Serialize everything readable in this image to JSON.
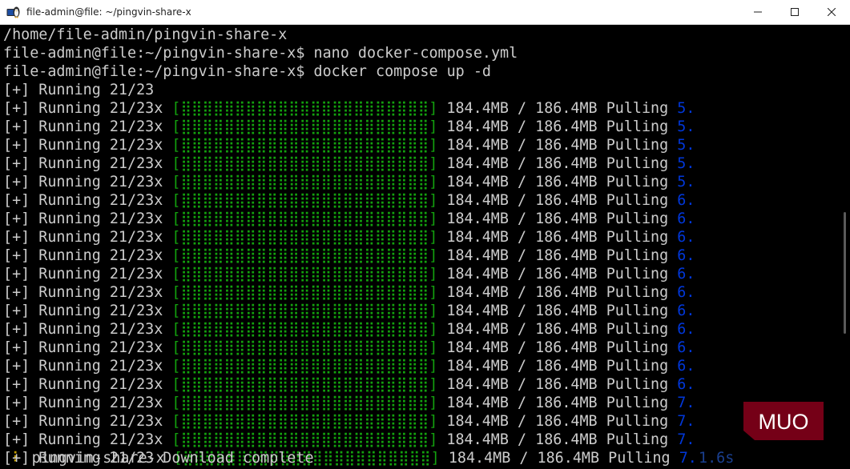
{
  "window": {
    "title": "file-admin@file: ~/pingvin-share-x",
    "app_icon": "penguin-terminal-icon",
    "buttons": {
      "minimize": "minimize-icon",
      "maximize": "maximize-icon",
      "close": "close-icon"
    }
  },
  "terminal": {
    "colors": {
      "background": "#000000",
      "text": "#cccccc",
      "progress": "#13a10e",
      "status": "#0037da"
    },
    "lines": [
      {
        "text": "/home/file-admin/pingvin-share-x"
      },
      {
        "text": "file-admin@file:~/pingvin-share-x$ nano docker-compose.yml"
      },
      {
        "text": "file-admin@file:~/pingvin-share-x$ docker compose up -d"
      },
      {
        "text": "[+] Running 21/23"
      }
    ],
    "progress_rows": [
      {
        "prefix": "[+] Running 21/23x ",
        "bar": "[⣿⣿⣿⣿⣿⣿⣿⣿⣿⣿⣿⣿⣿⣿⣿⣿⣿⣿⣿⣿⣿⣿⣿]",
        "size": " 184.4MB / 186.4MB Pulling ",
        "status": "5."
      },
      {
        "prefix": "[+] Running 21/23x ",
        "bar": "[⣿⣿⣿⣿⣿⣿⣿⣿⣿⣿⣿⣿⣿⣿⣿⣿⣿⣿⣿⣿⣿⣿⣿]",
        "size": " 184.4MB / 186.4MB Pulling ",
        "status": "5."
      },
      {
        "prefix": "[+] Running 21/23x ",
        "bar": "[⣿⣿⣿⣿⣿⣿⣿⣿⣿⣿⣿⣿⣿⣿⣿⣿⣿⣿⣿⣿⣿⣿⣿]",
        "size": " 184.4MB / 186.4MB Pulling ",
        "status": "5."
      },
      {
        "prefix": "[+] Running 21/23x ",
        "bar": "[⣿⣿⣿⣿⣿⣿⣿⣿⣿⣿⣿⣿⣿⣿⣿⣿⣿⣿⣿⣿⣿⣿⣿]",
        "size": " 184.4MB / 186.4MB Pulling ",
        "status": "5."
      },
      {
        "prefix": "[+] Running 21/23x ",
        "bar": "[⣿⣿⣿⣿⣿⣿⣿⣿⣿⣿⣿⣿⣿⣿⣿⣿⣿⣿⣿⣿⣿⣿⣿]",
        "size": " 184.4MB / 186.4MB Pulling ",
        "status": "5."
      },
      {
        "prefix": "[+] Running 21/23x ",
        "bar": "[⣿⣿⣿⣿⣿⣿⣿⣿⣿⣿⣿⣿⣿⣿⣿⣿⣿⣿⣿⣿⣿⣿⣿]",
        "size": " 184.4MB / 186.4MB Pulling ",
        "status": "6."
      },
      {
        "prefix": "[+] Running 21/23x ",
        "bar": "[⣿⣿⣿⣿⣿⣿⣿⣿⣿⣿⣿⣿⣿⣿⣿⣿⣿⣿⣿⣿⣿⣿⣿]",
        "size": " 184.4MB / 186.4MB Pulling ",
        "status": "6."
      },
      {
        "prefix": "[+] Running 21/23x ",
        "bar": "[⣿⣿⣿⣿⣿⣿⣿⣿⣿⣿⣿⣿⣿⣿⣿⣿⣿⣿⣿⣿⣿⣿⣿]",
        "size": " 184.4MB / 186.4MB Pulling ",
        "status": "6."
      },
      {
        "prefix": "[+] Running 21/23x ",
        "bar": "[⣿⣿⣿⣿⣿⣿⣿⣿⣿⣿⣿⣿⣿⣿⣿⣿⣿⣿⣿⣿⣿⣿⣿]",
        "size": " 184.4MB / 186.4MB Pulling ",
        "status": "6."
      },
      {
        "prefix": "[+] Running 21/23x ",
        "bar": "[⣿⣿⣿⣿⣿⣿⣿⣿⣿⣿⣿⣿⣿⣿⣿⣿⣿⣿⣿⣿⣿⣿⣿]",
        "size": " 184.4MB / 186.4MB Pulling ",
        "status": "6."
      },
      {
        "prefix": "[+] Running 21/23x ",
        "bar": "[⣿⣿⣿⣿⣿⣿⣿⣿⣿⣿⣿⣿⣿⣿⣿⣿⣿⣿⣿⣿⣿⣿⣿]",
        "size": " 184.4MB / 186.4MB Pulling ",
        "status": "6."
      },
      {
        "prefix": "[+] Running 21/23x ",
        "bar": "[⣿⣿⣿⣿⣿⣿⣿⣿⣿⣿⣿⣿⣿⣿⣿⣿⣿⣿⣿⣿⣿⣿⣿]",
        "size": " 184.4MB / 186.4MB Pulling ",
        "status": "6."
      },
      {
        "prefix": "[+] Running 21/23x ",
        "bar": "[⣿⣿⣿⣿⣿⣿⣿⣿⣿⣿⣿⣿⣿⣿⣿⣿⣿⣿⣿⣿⣿⣿⣿]",
        "size": " 184.4MB / 186.4MB Pulling ",
        "status": "6."
      },
      {
        "prefix": "[+] Running 21/23x ",
        "bar": "[⣿⣿⣿⣿⣿⣿⣿⣿⣿⣿⣿⣿⣿⣿⣿⣿⣿⣿⣿⣿⣿⣿⣿]",
        "size": " 184.4MB / 186.4MB Pulling ",
        "status": "6."
      },
      {
        "prefix": "[+] Running 21/23x ",
        "bar": "[⣿⣿⣿⣿⣿⣿⣿⣿⣿⣿⣿⣿⣿⣿⣿⣿⣿⣿⣿⣿⣿⣿⣿]",
        "size": " 184.4MB / 186.4MB Pulling ",
        "status": "6."
      },
      {
        "prefix": "[+] Running 21/23x ",
        "bar": "[⣿⣿⣿⣿⣿⣿⣿⣿⣿⣿⣿⣿⣿⣿⣿⣿⣿⣿⣿⣿⣿⣿⣿]",
        "size": " 184.4MB / 186.4MB Pulling ",
        "status": "6."
      },
      {
        "prefix": "[+] Running 21/23x ",
        "bar": "[⣿⣿⣿⣿⣿⣿⣿⣿⣿⣿⣿⣿⣿⣿⣿⣿⣿⣿⣿⣿⣿⣿⣿]",
        "size": " 184.4MB / 186.4MB Pulling ",
        "status": "7."
      },
      {
        "prefix": "[+] Running 21/23x ",
        "bar": "[⣿⣿⣿⣿⣿⣿⣿⣿⣿⣿⣿⣿⣿⣿⣿⣿⣿⣿⣿⣿⣿⣿⣿]",
        "size": " 184.4MB / 186.4MB Pulling ",
        "status": "7."
      },
      {
        "prefix": "[+] Running 21/23x ",
        "bar": "[⣿⣿⣿⣿⣿⣿⣿⣿⣿⣿⣿⣿⣿⣿⣿⣿⣿⣿⣿⣿⣿⣿⣿]",
        "size": " 184.4MB / 186.4MB Pulling ",
        "status": "7."
      },
      {
        "prefix": " ⠇ pingvin-share-x ",
        "bar": "[⣿⣿⣿⣿⣿⣿⣿⣿⣿⣿⣿⣿⣿⣿⣿⣿⣿⣿⣿⣿⣿⣿⣿]",
        "size": " 184.4MB / 186.4MB Pulling ",
        "status": "7."
      }
    ],
    "final_line": {
      "text": "[+] Running 21/23 Download complete",
      "duration": "1.6s"
    }
  },
  "watermark": {
    "text": "MUO"
  }
}
